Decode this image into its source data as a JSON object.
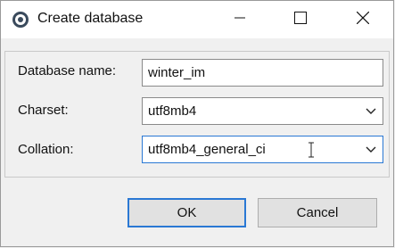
{
  "window": {
    "title": "Create database",
    "icon": "database-app-icon"
  },
  "form": {
    "database_name": {
      "label": "Database name:",
      "value": "winter_im"
    },
    "charset": {
      "label": "Charset:",
      "value": "utf8mb4"
    },
    "collation": {
      "label": "Collation:",
      "value": "utf8mb4_general_ci"
    }
  },
  "buttons": {
    "ok": "OK",
    "cancel": "Cancel"
  },
  "colors": {
    "accent": "#2a78d4",
    "background": "#f0f0f0"
  }
}
